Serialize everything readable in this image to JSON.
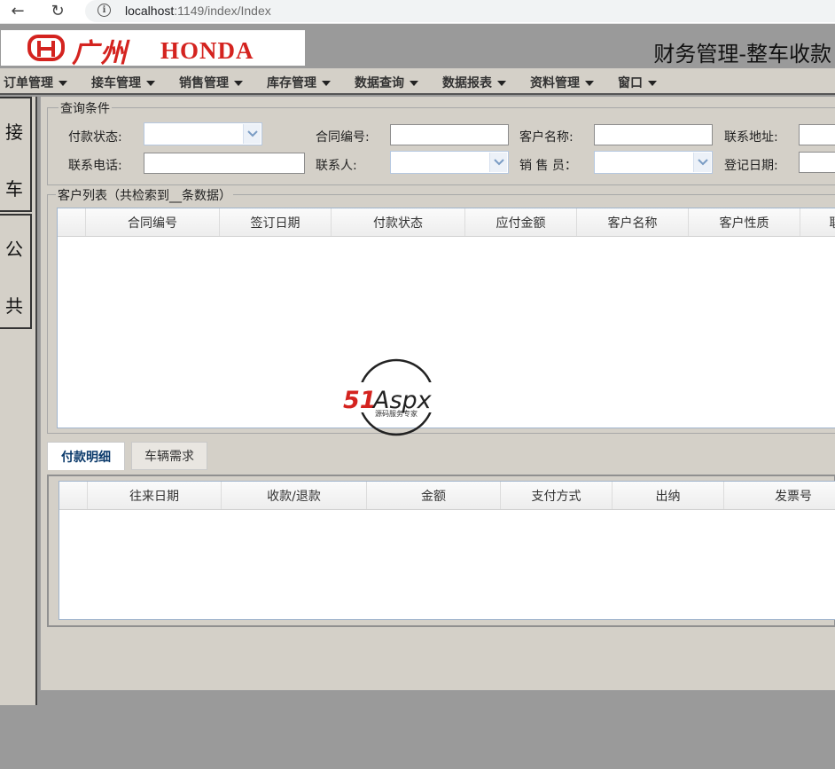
{
  "browser": {
    "url_host": "localhost",
    "url_rest": ":1149/index/Index"
  },
  "header": {
    "logo_cn": "广州",
    "logo_en": "HONDA",
    "title": "财务管理-整车收款"
  },
  "menu": [
    {
      "label": "订单管理"
    },
    {
      "label": "接车管理"
    },
    {
      "label": "销售管理"
    },
    {
      "label": "库存管理"
    },
    {
      "label": "数据查询"
    },
    {
      "label": "数据报表"
    },
    {
      "label": "资料管理"
    },
    {
      "label": "窗口"
    }
  ],
  "rail": {
    "tab1": [
      "接",
      "车"
    ],
    "tab2": [
      "公",
      "共"
    ]
  },
  "query": {
    "legend": "查询条件",
    "pay_status_label": "付款状态:",
    "contract_no_label": "合同编号:",
    "customer_name_label": "客户名称:",
    "address_label": "联系地址:",
    "phone_label": "联系电话:",
    "contact_label": "联系人:",
    "salesperson_label": "销 售 员：",
    "reg_date_label": "登记日期:",
    "pay_status_value": "",
    "contract_no_value": "",
    "customer_name_value": "",
    "address_value": "",
    "phone_value": "",
    "contact_value": "",
    "salesperson_value": "",
    "reg_date_value": ""
  },
  "customer_list": {
    "legend": "客户列表（共检索到__条数据）",
    "columns": [
      "合同编号",
      "签订日期",
      "付款状态",
      "应付金额",
      "客户名称",
      "客户性质",
      "联"
    ],
    "rows": []
  },
  "tabs": [
    {
      "label": "付款明细",
      "active": true
    },
    {
      "label": "车辆需求",
      "active": false
    }
  ],
  "payment_detail": {
    "columns": [
      "往来日期",
      "收款/退款",
      "金额",
      "支付方式",
      "出纳",
      "发票号"
    ],
    "rows": []
  },
  "watermark": {
    "brand": "51Aspx",
    "tagline": "源码服务专家"
  },
  "colors": {
    "brand_red": "#d4231f",
    "chrome_gray": "#9a9a9a",
    "panel_bg": "#d4d0c8",
    "active_tab_text": "#0b3a6b"
  }
}
